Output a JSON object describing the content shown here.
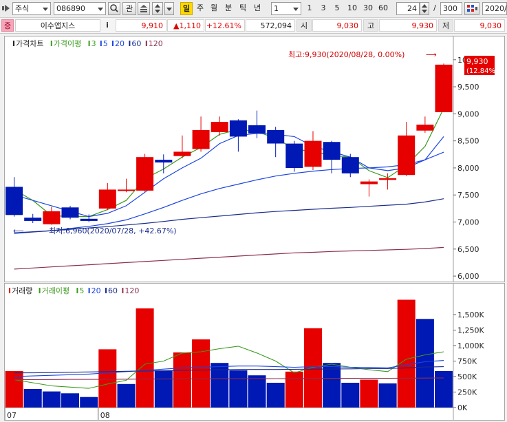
{
  "toolbar": {
    "market": "주식",
    "code": "086890",
    "watch_label": "관",
    "period_active": "일",
    "periods": [
      "주",
      "월",
      "분",
      "틱",
      "년"
    ],
    "interval_value": "1",
    "minute_options": [
      "1",
      "3",
      "5",
      "10",
      "30",
      "60"
    ],
    "count_value": "24",
    "slash": "/",
    "total_value": "300",
    "date_value": "2020/"
  },
  "info": {
    "badge": "증",
    "stock_name": "이수앱지스",
    "info_icon": "i",
    "price": "9,910",
    "change": "▲1,110",
    "change_pct": "+12.61%",
    "volume": "572,094",
    "open_label": "시",
    "open_value": "9,030",
    "high_label": "고",
    "high_value": "9,930",
    "low_label": "저",
    "low_value": "9,030"
  },
  "colors": {
    "up": "#e60000",
    "down": "#0018b4",
    "ma3": "#3c9a1e",
    "ma5": "#3c9a1e",
    "ma20": "#1a44e0",
    "ma60": "#1a2d8c",
    "ma120": "#8c2f4f"
  },
  "chart_data": [
    {
      "type": "candlestick",
      "legend": [
        {
          "label": "가격차트",
          "color": "#222222"
        },
        {
          "label": "가격이평",
          "color": "#3c9a1e"
        },
        {
          "label": "3",
          "color": "#3c9a1e"
        },
        {
          "label": "5",
          "color": "#1a44e0"
        },
        {
          "label": "20",
          "color": "#1a44e0"
        },
        {
          "label": "60",
          "color": "#1a2d8c"
        },
        {
          "label": "120",
          "color": "#8c2f4f"
        }
      ],
      "ylim": [
        5950,
        10150
      ],
      "yticks": [
        {
          "v": 6000,
          "label": "6,000"
        },
        {
          "v": 6500,
          "label": "6,500"
        },
        {
          "v": 7000,
          "label": "7,000"
        },
        {
          "v": 7500,
          "label": "7,500"
        },
        {
          "v": 8000,
          "label": "8,000"
        },
        {
          "v": 8500,
          "label": "8,500"
        },
        {
          "v": 9000,
          "label": "9,000"
        },
        {
          "v": 9500,
          "label": "9,500"
        },
        {
          "v": 10000,
          "label": "10,000"
        }
      ],
      "candles": [
        {
          "o": 7650,
          "h": 7830,
          "l": 7100,
          "c": 7130
        },
        {
          "o": 7080,
          "h": 7150,
          "l": 6980,
          "c": 7020
        },
        {
          "o": 6960,
          "h": 7280,
          "l": 6950,
          "c": 7200
        },
        {
          "o": 7270,
          "h": 7300,
          "l": 7050,
          "c": 7080
        },
        {
          "o": 7060,
          "h": 7140,
          "l": 7000,
          "c": 7020
        },
        {
          "o": 7250,
          "h": 7720,
          "l": 7220,
          "c": 7600
        },
        {
          "o": 7600,
          "h": 7800,
          "l": 7550,
          "c": 7600
        },
        {
          "o": 7580,
          "h": 8260,
          "l": 7560,
          "c": 8200
        },
        {
          "o": 8150,
          "h": 8250,
          "l": 7900,
          "c": 8100
        },
        {
          "o": 8220,
          "h": 8600,
          "l": 8180,
          "c": 8300
        },
        {
          "o": 8350,
          "h": 8950,
          "l": 8300,
          "c": 8700
        },
        {
          "o": 8660,
          "h": 8950,
          "l": 8600,
          "c": 8850
        },
        {
          "o": 8880,
          "h": 8900,
          "l": 8300,
          "c": 8580
        },
        {
          "o": 8790,
          "h": 9060,
          "l": 8550,
          "c": 8640
        },
        {
          "o": 8700,
          "h": 8760,
          "l": 8200,
          "c": 8450
        },
        {
          "o": 8450,
          "h": 8500,
          "l": 7930,
          "c": 8000
        },
        {
          "o": 8020,
          "h": 8680,
          "l": 7960,
          "c": 8500
        },
        {
          "o": 8480,
          "h": 8500,
          "l": 7900,
          "c": 8150
        },
        {
          "o": 8200,
          "h": 8260,
          "l": 7830,
          "c": 7900
        },
        {
          "o": 7700,
          "h": 7790,
          "l": 7470,
          "c": 7750
        },
        {
          "o": 7780,
          "h": 7900,
          "l": 7600,
          "c": 7810
        },
        {
          "o": 7870,
          "h": 8850,
          "l": 7850,
          "c": 8600
        },
        {
          "o": 8690,
          "h": 8950,
          "l": 8650,
          "c": 8800
        },
        {
          "o": 9030,
          "h": 9930,
          "l": 9030,
          "c": 9910
        }
      ],
      "ma": [
        {
          "name": "3",
          "color": "#3c9a1e",
          "values": [
            7600,
            7400,
            7120,
            7100,
            7100,
            7230,
            7400,
            7800,
            7980,
            8200,
            8380,
            8620,
            8710,
            8670,
            8550,
            8350,
            8300,
            8230,
            8200,
            7950,
            7820,
            8050,
            8400,
            9100
          ]
        },
        {
          "name": "5",
          "color": "#1a44e0",
          "values": [
            7500,
            7400,
            7300,
            7200,
            7100,
            7160,
            7300,
            7550,
            7800,
            8000,
            8180,
            8450,
            8600,
            8640,
            8620,
            8580,
            8400,
            8300,
            8200,
            8000,
            7950,
            8000,
            8150,
            8580
          ]
        },
        {
          "name": "20",
          "color": "#1a44e0",
          "values": [
            6800,
            6820,
            6840,
            6880,
            6920,
            6970,
            7040,
            7150,
            7270,
            7400,
            7520,
            7620,
            7700,
            7780,
            7850,
            7900,
            7940,
            7970,
            7990,
            8000,
            8020,
            8060,
            8150,
            8290
          ]
        },
        {
          "name": "60",
          "color": "#1a2d8c",
          "values": [
            6790,
            6815,
            6840,
            6865,
            6890,
            6915,
            6945,
            6975,
            7010,
            7050,
            7080,
            7110,
            7140,
            7170,
            7195,
            7215,
            7235,
            7255,
            7270,
            7290,
            7310,
            7330,
            7370,
            7430
          ]
        },
        {
          "name": "120",
          "color": "#8c2f4f",
          "values": [
            6130,
            6150,
            6170,
            6190,
            6210,
            6230,
            6250,
            6270,
            6290,
            6310,
            6330,
            6350,
            6370,
            6390,
            6410,
            6430,
            6440,
            6455,
            6465,
            6475,
            6485,
            6495,
            6510,
            6530
          ]
        }
      ],
      "annotations": {
        "max_label": "최고:9,930(2020/08/28, 0.00%)",
        "max_arrow": "⟶",
        "min_label": "최저:6,960(2020/07/28, +42.67%)",
        "min_arrow": "⟵",
        "last_price_label": "9,930",
        "last_pct_label": "(12.84%)"
      }
    },
    {
      "type": "bar",
      "legend": [
        {
          "label": "거래량",
          "color": "#222222"
        },
        {
          "label": "거래이평",
          "color": "#3c9a1e"
        },
        {
          "label": "5",
          "color": "#3c9a1e"
        },
        {
          "label": "20",
          "color": "#1a44e0"
        },
        {
          "label": "60",
          "color": "#1a2d8c"
        },
        {
          "label": "120",
          "color": "#8c2f4f"
        }
      ],
      "ylim": [
        0,
        1800000
      ],
      "yticks": [
        {
          "v": 0,
          "label": "0K"
        },
        {
          "v": 250000,
          "label": "250K"
        },
        {
          "v": 500000,
          "label": "500K"
        },
        {
          "v": 750000,
          "label": "750K"
        },
        {
          "v": 1000000,
          "label": "1,000K"
        },
        {
          "v": 1250000,
          "label": "1,250K"
        },
        {
          "v": 1500000,
          "label": "1,500K"
        }
      ],
      "values": [
        590000,
        300000,
        260000,
        230000,
        170000,
        940000,
        380000,
        1600000,
        600000,
        890000,
        1100000,
        720000,
        600000,
        520000,
        400000,
        580000,
        1280000,
        720000,
        400000,
        450000,
        390000,
        1740000,
        1430000,
        590000
      ],
      "up": [
        true,
        false,
        false,
        false,
        false,
        true,
        false,
        true,
        false,
        true,
        true,
        false,
        false,
        false,
        false,
        true,
        true,
        false,
        false,
        true,
        false,
        true,
        false,
        false
      ],
      "ma": [
        {
          "name": "5",
          "color": "#3c9a1e",
          "values": [
            450000,
            400000,
            350000,
            330000,
            310000,
            380000,
            440000,
            700000,
            750000,
            880000,
            900000,
            950000,
            990000,
            880000,
            750000,
            560000,
            650000,
            700000,
            650000,
            610000,
            580000,
            780000,
            850000,
            900000
          ]
        },
        {
          "name": "20",
          "color": "#1a44e0",
          "values": [
            500000,
            510000,
            520000,
            530000,
            540000,
            560000,
            580000,
            600000,
            620000,
            640000,
            650000,
            660000,
            670000,
            670000,
            660000,
            650000,
            660000,
            660000,
            650000,
            650000,
            640000,
            690000,
            740000,
            760000
          ]
        },
        {
          "name": "60",
          "color": "#1a2d8c",
          "values": [
            560000,
            560000,
            565000,
            570000,
            575000,
            580000,
            585000,
            590000,
            595000,
            600000,
            605000,
            610000,
            615000,
            615000,
            615000,
            618000,
            620000,
            622000,
            625000,
            628000,
            630000,
            640000,
            655000,
            660000
          ]
        },
        {
          "name": "120",
          "color": "#8c2f4f",
          "values": [
            450000,
            450000,
            452000,
            454000,
            455000,
            456000,
            458000,
            460000,
            461000,
            462000,
            463000,
            464000,
            465000,
            466000,
            467000,
            468000,
            469000,
            470000,
            471000,
            472000,
            472000,
            474000,
            476000,
            478000
          ]
        }
      ],
      "x_labels": [
        {
          "index": 0,
          "label": "07"
        },
        {
          "index": 5,
          "label": "08"
        }
      ]
    }
  ]
}
